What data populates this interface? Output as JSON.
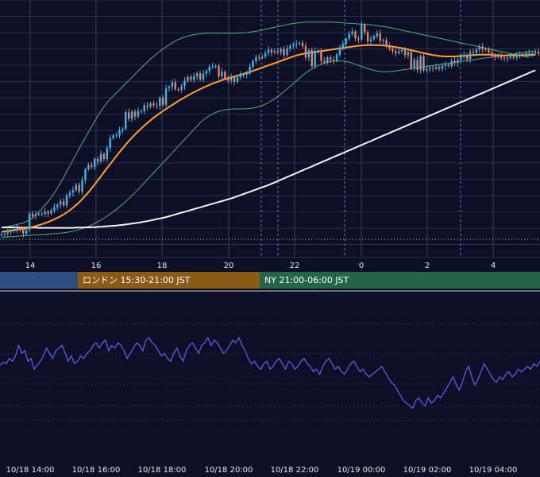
{
  "colors": {
    "background": "#0d0f26",
    "grid": "#2a2d47",
    "vline": "#3a3e5a",
    "marker": "#5a7fc0",
    "candle_up": "#3fb6e8",
    "candle_down": "#e8826a",
    "bollinger": "#4fb07a",
    "ma_short": "#ff9f2e",
    "ma_long": "#f2f2f2",
    "oscillator": "#5b5ce6",
    "session_asia": "#2a4f82",
    "session_london": "#8b5a14",
    "session_ny": "#236646"
  },
  "sessions": [
    {
      "key": "asia",
      "label": ""
    },
    {
      "key": "london",
      "label": "ロンドン 15:30-21:00 JST"
    },
    {
      "key": "ny",
      "label": "NY 21:00-06:00 JST"
    }
  ],
  "chart_data": [
    {
      "type": "candlestick",
      "x_ticks": [
        "14",
        "16",
        "18",
        "20",
        "22",
        "0",
        "2",
        "4"
      ],
      "overlays": [
        "bollinger_bands",
        "moving_average_short",
        "moving_average_long"
      ],
      "ylim": [
        0,
        100
      ],
      "grid": true,
      "key_levels": [
        5
      ],
      "open": [
        1.5,
        1.9,
        2.3,
        3.4,
        3.3,
        3.7,
        4.6,
        4.1,
        2.2,
        3.9,
        11.2,
        10.1,
        10.7,
        11.1,
        11.0,
        12.1,
        11.2,
        12.5,
        14.1,
        15.1,
        16.7,
        14.9,
        19.4,
        20.6,
        21.7,
        24.1,
        21.0,
        26.2,
        31.1,
        32.9,
        32.1,
        35.7,
        34.5,
        38.0,
        35.7,
        40.6,
        45.0,
        46.3,
        46.4,
        48.7,
        49.3,
        56.7,
        53.7,
        57.0,
        54.8,
        57.2,
        57.2,
        59.8,
        59.2,
        60.7,
        59.9,
        59.6,
        63.3,
        60.1,
        67.5,
        68.1,
        70.2,
        67.1,
        66.8,
        68.4,
        70.8,
        72.6,
        71.3,
        72.9,
        74.2,
        71.4,
        74.1,
        75.3,
        77.0,
        77.4,
        77.5,
        72.8,
        74.9,
        72.0,
        70.9,
        72.5,
        70.4,
        72.4,
        73.5,
        73.6,
        74.1,
        77.1,
        79.7,
        81.4,
        81.3,
        81.7,
        83.3,
        84.8,
        83.5,
        84.2,
        83.7,
        85.2,
        82.4,
        85.2,
        86.6,
        87.2,
        87.5,
        87.8,
        86.4,
        81.3,
        84.6,
        77.5,
        84.3,
        84.4,
        79.8,
        79.1,
        81.3,
        80.3,
        80.0,
        82.6,
        85.8,
        87.4,
        89.7,
        92.0,
        93.0,
        89.9,
        89.4,
        96.1,
        92.6,
        88.6,
        89.5,
        90.9,
        92.2,
        88.8,
        89.1,
        86.4,
        85.3,
        84.1,
        83.3,
        84.1,
        84.8,
        82.4,
        83.8,
        76.4,
        80.2,
        75.8,
        81.9,
        75.5,
        76.1,
        76.6,
        76.4,
        77.0,
        76.3,
        77.5,
        78.0,
        77.5,
        79.8,
        78.9,
        80.3,
        81.6,
        82.5,
        80.6,
        83.8,
        83.5,
        84.9,
        86.2,
        85.0,
        84.8,
        83.6,
        82.5,
        81.6,
        82.0,
        81.2,
        80.9,
        81.0,
        81.5,
        81.4,
        82.5,
        82.6,
        82.5,
        83.2,
        83.2,
        83.2,
        83.8
      ],
      "close": [
        1.9,
        2.3,
        3.4,
        3.3,
        3.7,
        4.6,
        4.1,
        2.2,
        3.9,
        11.2,
        10.1,
        10.7,
        11.1,
        11.0,
        12.1,
        11.2,
        12.5,
        14.1,
        15.1,
        16.7,
        14.9,
        19.4,
        20.6,
        21.7,
        24.1,
        21.0,
        26.2,
        31.1,
        32.9,
        32.1,
        35.7,
        34.5,
        38.0,
        35.7,
        40.6,
        45.0,
        46.3,
        46.4,
        48.7,
        49.3,
        56.7,
        53.7,
        57.0,
        54.8,
        57.2,
        57.2,
        59.8,
        59.2,
        60.7,
        59.9,
        59.6,
        63.3,
        60.1,
        67.5,
        68.1,
        70.2,
        67.1,
        66.8,
        68.4,
        70.8,
        72.6,
        71.3,
        72.9,
        74.2,
        71.4,
        74.1,
        75.3,
        77.0,
        77.4,
        77.5,
        72.8,
        74.9,
        72.0,
        70.9,
        72.5,
        70.4,
        72.4,
        73.5,
        73.6,
        74.1,
        77.1,
        79.7,
        81.4,
        81.3,
        81.7,
        83.3,
        84.8,
        83.5,
        84.2,
        83.7,
        85.2,
        82.4,
        85.2,
        86.6,
        87.2,
        87.5,
        87.8,
        86.4,
        81.3,
        84.6,
        77.5,
        84.3,
        84.4,
        79.8,
        79.1,
        81.3,
        80.3,
        80.0,
        82.6,
        85.8,
        87.4,
        89.7,
        92.0,
        93.0,
        89.9,
        89.4,
        96.1,
        92.6,
        88.6,
        89.5,
        90.9,
        92.2,
        88.8,
        89.1,
        86.4,
        85.3,
        84.1,
        83.3,
        84.1,
        84.8,
        82.4,
        83.8,
        76.4,
        80.2,
        75.8,
        81.9,
        75.5,
        76.1,
        76.6,
        76.4,
        77.0,
        76.3,
        77.5,
        78.0,
        77.5,
        79.8,
        78.9,
        80.3,
        81.6,
        82.5,
        80.6,
        83.8,
        83.5,
        84.9,
        86.2,
        85.0,
        84.8,
        83.6,
        82.5,
        81.6,
        82.0,
        81.2,
        80.9,
        81.0,
        81.5,
        81.4,
        82.5,
        82.6,
        82.5,
        83.2,
        83.2,
        83.2,
        83.8,
        83.0
      ],
      "ma_short": [
        3.0,
        3.2,
        3.4,
        3.6,
        3.8,
        4.0,
        4.2,
        4.4,
        4.6,
        4.9,
        5.2,
        5.6,
        6.0,
        6.4,
        6.9,
        7.4,
        8.0,
        8.6,
        9.3,
        10.0,
        10.8,
        11.7,
        12.7,
        13.8,
        15.0,
        16.3,
        17.7,
        19.2,
        20.8,
        22.5,
        24.3,
        26.1,
        27.9,
        29.8,
        31.6,
        33.4,
        35.2,
        37.0,
        38.8,
        40.5,
        42.2,
        43.8,
        45.3,
        46.7,
        48.1,
        49.4,
        50.7,
        51.9,
        53.1,
        54.2,
        55.3,
        56.3,
        57.3,
        58.2,
        59.1,
        60.0,
        60.9,
        61.8,
        62.6,
        63.4,
        64.2,
        65.0,
        65.7,
        66.4,
        67.1,
        67.8,
        68.4,
        69.0,
        69.6,
        70.1,
        70.6,
        71.1,
        71.6,
        72.0,
        72.4,
        72.8,
        73.2,
        73.6,
        74.0,
        74.4,
        74.8,
        75.3,
        75.8,
        76.3,
        76.8,
        77.3,
        77.8,
        78.3,
        78.8,
        79.3,
        79.8,
        80.3,
        80.8,
        81.3,
        81.8,
        82.2,
        82.6,
        82.9,
        83.2,
        83.4,
        83.6,
        83.8,
        84.0,
        84.2,
        84.4,
        84.6,
        84.8,
        85.0,
        85.2,
        85.4,
        85.6,
        85.8,
        86.0,
        86.2,
        86.4,
        86.6,
        86.7,
        86.8,
        86.9,
        86.9,
        86.9,
        86.9,
        86.8,
        86.7,
        86.6,
        86.4,
        86.2,
        86.0,
        85.8,
        85.5,
        85.2,
        84.9,
        84.6,
        84.3,
        84.0,
        83.6,
        83.3,
        83.0,
        82.7,
        82.4,
        82.2,
        82.0,
        81.9,
        81.8,
        81.8,
        81.8,
        81.8,
        81.9,
        82.0,
        82.1,
        82.2,
        82.3,
        82.4,
        82.5,
        82.6,
        82.6,
        82.6,
        82.6,
        82.5,
        82.4,
        82.3,
        82.2,
        82.2,
        82.2,
        82.2,
        82.3,
        82.3,
        82.3,
        82.4,
        82.4,
        82.4,
        82.5,
        82.5
      ],
      "ma_long": [
        5.0,
        5.0,
        5.0,
        5.0,
        5.0,
        5.0,
        4.9,
        4.9,
        4.9,
        4.9,
        4.9,
        4.9,
        4.8,
        4.8,
        4.8,
        4.8,
        4.8,
        4.8,
        4.8,
        4.8,
        4.8,
        4.8,
        4.8,
        4.8,
        4.9,
        4.9,
        4.9,
        5.0,
        5.0,
        5.1,
        5.1,
        5.2,
        5.3,
        5.4,
        5.5,
        5.6,
        5.7,
        5.8,
        6.0,
        6.1,
        6.3,
        6.5,
        6.7,
        6.9,
        7.1,
        7.3,
        7.6,
        7.8,
        8.1,
        8.4,
        8.7,
        9.0,
        9.3,
        9.6,
        10.0,
        10.4,
        10.8,
        11.2,
        11.6,
        12.0,
        12.4,
        12.8,
        13.2,
        13.6,
        14.0,
        14.4,
        14.8,
        15.2,
        15.6,
        16.0,
        16.4,
        16.8,
        17.2,
        17.6,
        18.0,
        18.5,
        19.0,
        19.5,
        20.0,
        20.5,
        21.0,
        21.5,
        22.0,
        22.5,
        23.0,
        23.5,
        24.0,
        24.6,
        25.2,
        25.8,
        26.4,
        27.0,
        27.6,
        28.2,
        28.8,
        29.4,
        30.0,
        30.6,
        31.2,
        31.8,
        32.4,
        33.0,
        33.6,
        34.2,
        34.8,
        35.4,
        36.0,
        36.6,
        37.2,
        37.8,
        38.4,
        39.0,
        39.6,
        40.2,
        40.8,
        41.4,
        42.0,
        42.6,
        43.2,
        43.8,
        44.4,
        45.0,
        45.6,
        46.2,
        46.8,
        47.4,
        48.0,
        48.6,
        49.2,
        49.8,
        50.4,
        51.0,
        51.6,
        52.2,
        52.8,
        53.4,
        54.0,
        54.6,
        55.2,
        55.8,
        56.4,
        57.0,
        57.6,
        58.2,
        58.8,
        59.4,
        60.0,
        60.6,
        61.2,
        61.8,
        62.4,
        63.0,
        63.6,
        64.2,
        64.8,
        65.4,
        66.0,
        66.6,
        67.2,
        67.8,
        68.4,
        69.0,
        69.6,
        70.2,
        70.8,
        71.4,
        72.0,
        72.6,
        73.2,
        73.8,
        74.4,
        75.0,
        75.6
      ],
      "bb_upper": [
        5.0,
        5.2,
        5.4,
        5.7,
        6.0,
        6.3,
        6.6,
        7.0,
        7.6,
        8.4,
        9.4,
        10.6,
        12.0,
        13.4,
        15.0,
        16.6,
        18.4,
        20.4,
        22.6,
        25.0,
        27.4,
        30.0,
        32.6,
        35.2,
        37.8,
        40.4,
        43.0,
        45.4,
        47.8,
        50.2,
        52.6,
        55.0,
        57.2,
        59.2,
        61.0,
        62.6,
        64.0,
        65.4,
        66.8,
        68.2,
        69.6,
        71.0,
        72.4,
        73.8,
        75.2,
        76.6,
        78.0,
        79.3,
        80.6,
        81.8,
        83.0,
        84.1,
        85.1,
        86.1,
        87.0,
        87.9,
        88.7,
        89.4,
        90.0,
        90.5,
        90.9,
        91.3,
        91.6,
        91.8,
        92.0,
        92.1,
        92.2,
        92.2,
        92.2,
        92.2,
        92.2,
        92.2,
        92.2,
        92.2,
        92.2,
        92.2,
        92.2,
        92.3,
        92.4,
        92.5,
        92.7,
        92.9,
        93.1,
        93.4,
        93.7,
        94.0,
        94.3,
        94.6,
        94.9,
        95.2,
        95.5,
        95.8,
        96.1,
        96.4,
        96.6,
        96.8,
        97.0,
        97.1,
        97.2,
        97.2,
        97.2,
        97.2,
        97.2,
        97.2,
        97.2,
        97.2,
        97.2,
        97.2,
        97.1,
        97.0,
        96.9,
        96.8,
        96.7,
        96.6,
        96.5,
        96.4,
        96.3,
        96.2,
        96.1,
        96.0,
        95.8,
        95.6,
        95.4,
        95.2,
        95.0,
        94.8,
        94.5,
        94.2,
        93.9,
        93.6,
        93.3,
        93.0,
        92.7,
        92.4,
        92.1,
        91.8,
        91.5,
        91.2,
        90.9,
        90.6,
        90.3,
        90.0,
        89.7,
        89.4,
        89.1,
        88.8,
        88.5,
        88.2,
        87.9,
        87.6,
        87.3,
        87.0,
        86.7,
        86.4,
        86.1,
        85.8,
        85.5,
        85.2,
        84.9,
        84.6,
        84.3,
        84.0,
        83.7,
        83.4,
        83.1,
        82.8,
        82.5,
        82.2,
        81.9,
        81.6,
        81.3
      ],
      "bb_lower": [
        0.5,
        0.6,
        0.7,
        0.8,
        0.9,
        1.0,
        1.1,
        1.2,
        1.3,
        1.4,
        1.5,
        1.6,
        1.7,
        1.8,
        1.9,
        2.0,
        2.1,
        2.2,
        2.3,
        2.4,
        2.6,
        2.8,
        3.0,
        3.3,
        3.6,
        4.0,
        4.4,
        4.9,
        5.5,
        6.1,
        6.8,
        7.5,
        8.3,
        9.1,
        10.0,
        11.0,
        12.0,
        13.1,
        14.2,
        15.4,
        16.6,
        17.9,
        19.2,
        20.6,
        22.0,
        23.5,
        25.0,
        26.5,
        28.0,
        29.5,
        31.0,
        32.5,
        34.0,
        35.5,
        37.0,
        38.5,
        40.0,
        41.5,
        43.0,
        44.5,
        46.0,
        47.5,
        49.0,
        50.5,
        52.0,
        53.2,
        54.3,
        55.2,
        56.0,
        56.6,
        57.1,
        57.5,
        57.8,
        58.0,
        58.1,
        58.2,
        58.2,
        58.2,
        58.2,
        58.3,
        58.4,
        58.6,
        58.9,
        59.3,
        59.8,
        60.4,
        61.1,
        61.9,
        62.8,
        63.8,
        64.9,
        66.0,
        67.2,
        68.4,
        69.6,
        70.8,
        72.0,
        73.2,
        74.3,
        75.3,
        76.2,
        77.0,
        77.7,
        78.3,
        78.8,
        79.2,
        79.5,
        79.7,
        79.8,
        79.8,
        79.7,
        79.5,
        79.2,
        78.8,
        78.3,
        77.8,
        77.3,
        76.8,
        76.3,
        75.9,
        75.5,
        75.2,
        75.0,
        74.9,
        74.9,
        75.0,
        75.1,
        75.3,
        75.5,
        75.7,
        75.9,
        76.1,
        76.3,
        76.5,
        76.7,
        76.9,
        77.1,
        77.3,
        77.5,
        77.7,
        77.9,
        78.1,
        78.3,
        78.5,
        78.7,
        78.9,
        79.1,
        79.3,
        79.5,
        79.7,
        79.9,
        80.1,
        80.3,
        80.5,
        80.7,
        80.9,
        81.1,
        81.3,
        81.5,
        81.7,
        81.9,
        82.1,
        82.3,
        82.5,
        82.7,
        82.9,
        83.1,
        83.3,
        83.5,
        83.7,
        83.9,
        84.1,
        84.3
      ]
    },
    {
      "type": "line",
      "name": "",
      "x_ticks": [
        "10/18 14:00",
        "10/18 16:00",
        "10/18 18:00",
        "10/18 20:00",
        "10/18 22:00",
        "10/19 00:00",
        "10/19 02:00",
        "10/19 04:00"
      ],
      "ylim": [
        0,
        100
      ],
      "grid": true,
      "values": [
        55,
        57,
        56,
        60,
        58,
        62,
        70,
        64,
        66,
        58,
        60,
        52,
        55,
        58,
        62,
        68,
        64,
        60,
        66,
        68,
        70,
        64,
        58,
        62,
        56,
        58,
        62,
        60,
        64,
        66,
        70,
        72,
        68,
        72,
        74,
        66,
        70,
        68,
        72,
        70,
        66,
        60,
        64,
        68,
        72,
        70,
        66,
        74,
        76,
        72,
        70,
        66,
        62,
        64,
        60,
        58,
        64,
        68,
        62,
        58,
        66,
        70,
        72,
        68,
        64,
        70,
        72,
        76,
        70,
        74,
        72,
        68,
        64,
        66,
        70,
        74,
        72,
        76,
        70,
        66,
        60,
        56,
        58,
        54,
        52,
        56,
        58,
        52,
        54,
        58,
        60,
        56,
        52,
        58,
        56,
        52,
        54,
        58,
        60,
        56,
        54,
        50,
        52,
        48,
        54,
        58,
        60,
        56,
        52,
        54,
        50,
        48,
        52,
        56,
        58,
        54,
        50,
        52,
        48,
        46,
        48,
        50,
        52,
        54,
        50,
        46,
        42,
        40,
        36,
        32,
        28,
        26,
        24,
        22,
        28,
        30,
        26,
        24,
        30,
        26,
        28,
        32,
        30,
        34,
        38,
        42,
        46,
        40,
        36,
        42,
        50,
        54,
        46,
        40,
        44,
        50,
        56,
        52,
        48,
        44,
        42,
        46,
        44,
        48,
        50,
        46,
        48,
        52,
        50,
        52,
        54,
        52,
        56,
        54,
        58
      ]
    }
  ]
}
